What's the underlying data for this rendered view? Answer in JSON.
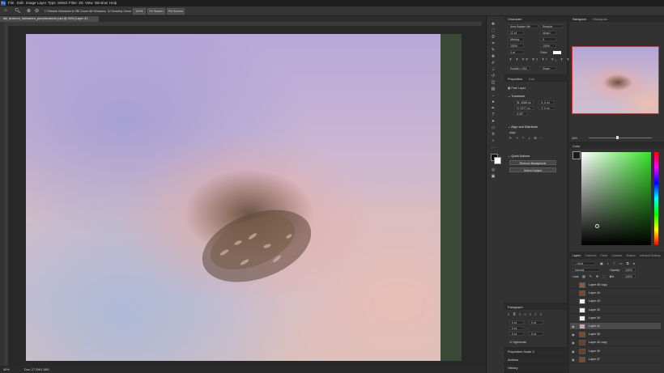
{
  "menu": [
    "File",
    "Edit",
    "Image",
    "Layer",
    "Type",
    "Select",
    "Filter",
    "3D",
    "View",
    "Window",
    "Help"
  ],
  "options_bar": {
    "checkbox_resize": "Resize Windows to Fit",
    "checkbox_zoom_all": "Zoom All Windows",
    "checkbox_scrubby": "Scrubby Zoom",
    "btn_100": "100%",
    "btn_fit": "Fit Screen",
    "btn_fill": "Fill Screen"
  },
  "document_tab": "fall_textured_halloween_pumpkinsbrich.psd @ 40% (Layer 41, RGB/8#) *",
  "status": {
    "zoom": "40%",
    "doc": "Doc: 27.2M/1.58G"
  },
  "panels": {
    "character": {
      "title": "Character",
      "font_family": "Ama Badam Me",
      "font_style": "Regular",
      "size": "12 pt",
      "leading": "(Auto)",
      "kerning": "Metrics",
      "tracking": "0",
      "scale_v": "100%",
      "scale_h": "100%",
      "baseline": "0 pt",
      "color_label": "Color:",
      "language": "English: USA",
      "aa": "Sharp"
    },
    "properties": {
      "tabs": [
        "Properties",
        "Info"
      ],
      "kind": "Pixel Layer",
      "transform_label": "Transform",
      "w": "W: 4088 px",
      "h": "H: 2377 px",
      "x": "X: 0 px",
      "y": "Y: 0 px",
      "angle": "0.00°",
      "align_label": "Align and Distribute",
      "align_sub": "Align:",
      "quick_actions": "Quick Actions",
      "remove_bg": "Remove Background",
      "select_subject": "Select Subject"
    },
    "paragraph": {
      "title": "Paragraph",
      "indent_values": [
        "0 pt",
        "0 pt",
        "0 pt",
        "0 pt",
        "0 pt"
      ],
      "hyphenate": "Hyphenate"
    },
    "bottom_tabs": [
      "Properties Scale 2",
      "Actions",
      "History"
    ],
    "navigator": {
      "tabs": [
        "Navigator",
        "Histogram"
      ],
      "zoom": "40%"
    },
    "color": {
      "title": "Color"
    },
    "layers": {
      "tabs": [
        "Layers",
        "Channels",
        "Paths",
        "Libraries",
        "Shapes",
        "Artboard Settings"
      ],
      "search": "Kind",
      "blend": "Normal",
      "opacity_label": "Opacity:",
      "opacity": "100%",
      "lock_label": "Lock:",
      "fill_label": "Fill:",
      "fill": "100%",
      "rows": [
        {
          "name": "Layer 45 copy",
          "visible": false,
          "thumb": "#8c5a3c"
        },
        {
          "name": "Layer 44",
          "visible": false,
          "thumb": "#7a4a2f"
        },
        {
          "name": "Layer 43",
          "visible": false,
          "thumb": "#f0f0f0"
        },
        {
          "name": "Layer 42",
          "visible": false,
          "thumb": "#eeeeee"
        },
        {
          "name": "Layer 39",
          "visible": false,
          "thumb": "#efefef"
        },
        {
          "name": "Layer 41",
          "visible": true,
          "thumb": "#c9a8b6"
        },
        {
          "name": "Layer 38",
          "visible": true,
          "thumb": "#7a4a2f"
        },
        {
          "name": "Layer 40 copy",
          "visible": true,
          "thumb": "#6b4027"
        },
        {
          "name": "Layer 39",
          "visible": true,
          "thumb": "#6e3f25"
        },
        {
          "name": "Layer 37",
          "visible": true,
          "thumb": "#7c4a2d"
        }
      ]
    }
  },
  "colors": {
    "accent": "#2680eb",
    "selected_row": "#4b4b4b"
  }
}
